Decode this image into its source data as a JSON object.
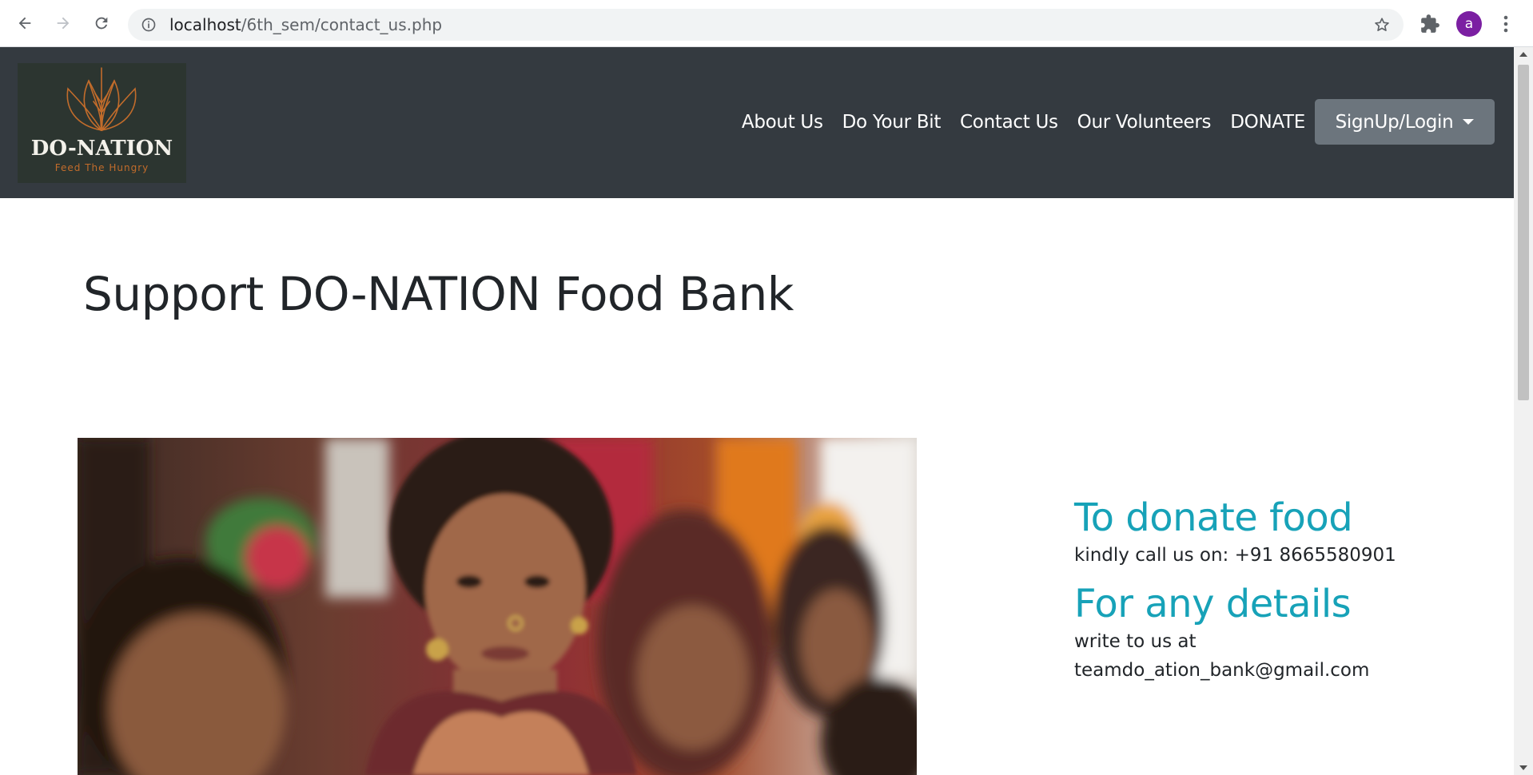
{
  "browser": {
    "url_host": "localhost",
    "url_path": "/6th_sem/contact_us.php",
    "profile_initial": "a"
  },
  "site": {
    "logo": {
      "brand": "DO-NATION",
      "tagline": "Feed The Hungry"
    },
    "nav": {
      "items": [
        {
          "label": "About Us"
        },
        {
          "label": "Do Your Bit"
        },
        {
          "label": "Contact Us"
        },
        {
          "label": "Our Volunteers"
        },
        {
          "label": "DONATE"
        }
      ],
      "signup_label": "SignUp/Login"
    }
  },
  "main": {
    "title": "Support DO-NATION Food Bank",
    "contact": {
      "donate_heading": "To donate food",
      "donate_text": "kindly call us on: +91 8665580901",
      "details_heading": "For any details",
      "details_text_line1": "write to us at",
      "details_text_line2": "teamdo_ation_bank@gmail.com"
    }
  },
  "colors": {
    "navbar": "#343a40",
    "accent": "#17a2b8",
    "button": "#6c757d",
    "logo_orange": "#c26c2b"
  }
}
